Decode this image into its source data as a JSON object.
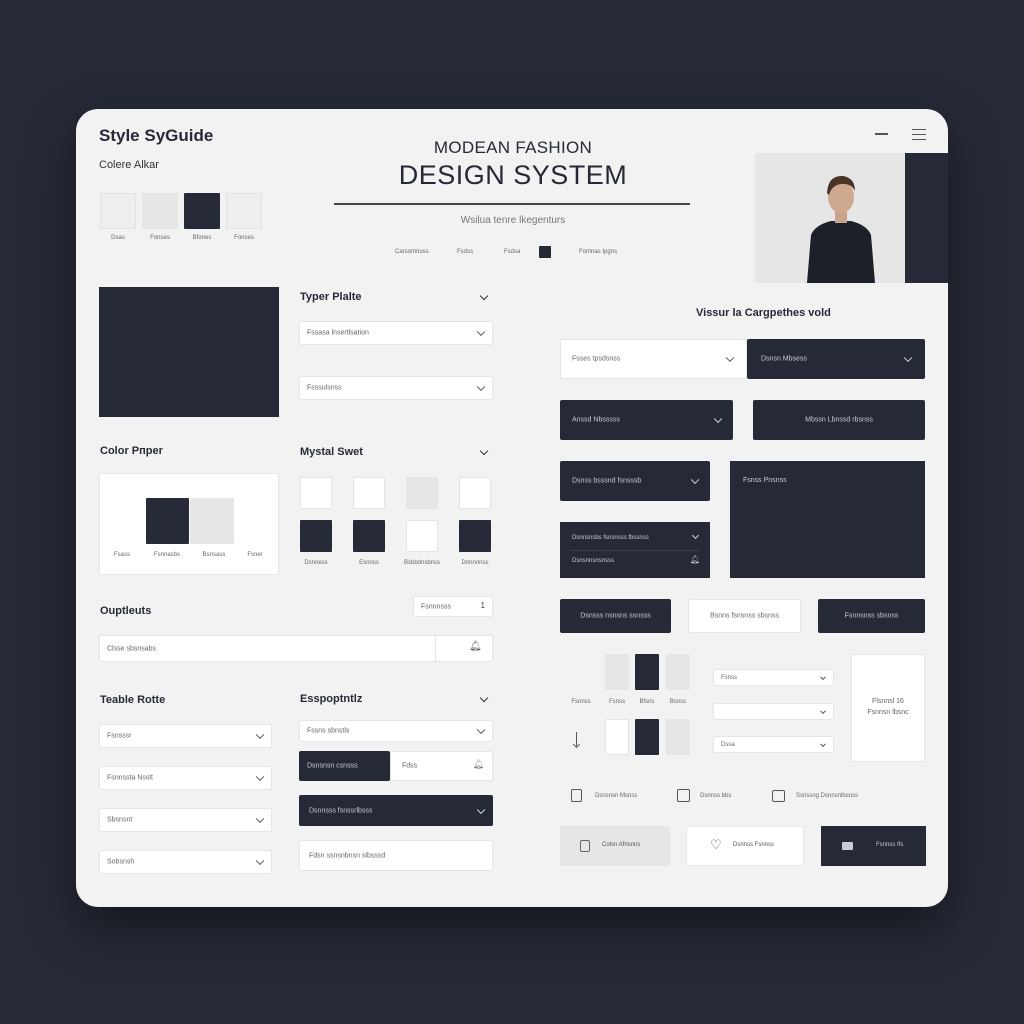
{
  "header": {
    "app_title": "Style SyGuide",
    "colors_label": "Colere Alkar",
    "hero_line1": "MODEAN FASHION",
    "hero_line2": "DESIGN SYSTEM",
    "hero_sub": "Wsilua tenre lkegenturs",
    "hero_links": [
      "Carsomnuss",
      "Fsdss",
      "Fsdsa",
      "Fomnas Ipgns"
    ]
  },
  "top_swatches": {
    "colors": [
      "#eeeeee",
      "#e6e6e6",
      "#262a36",
      "#eeeeee"
    ],
    "labels": [
      "Dsas",
      "Fonses",
      "Bfones",
      "Fonses"
    ]
  },
  "type_palette": {
    "title": "Typer Plalte",
    "fields": [
      "Fssasa lnsertlsation",
      "Fsssulsnss"
    ]
  },
  "color_paper": {
    "title": "Color Pпper",
    "labels": [
      "Fsass",
      "Fsnnasbs",
      "Bsnsass",
      "Fsner"
    ]
  },
  "mystal_swet": {
    "title": "Mystal Swet",
    "labels": [
      "Dsnness",
      "Esnnss",
      "Bsbbdnsbnss",
      "Dnnnnnss"
    ]
  },
  "outfields": {
    "title": "Ouptleuts",
    "counter_label": "Fsnnnsss",
    "counter_value": "1",
    "input_placeholder": "Clsse sbsnsabs"
  },
  "table_rotte": {
    "title": "Teable Rotte",
    "fields": [
      "Fsnsssr",
      "Fsnnssta Nsslt",
      "Sbsnsnt",
      "Sobsnsh"
    ]
  },
  "exports": {
    "title": "Esspoрtntlz",
    "field1": "Fssns sbnstls",
    "split_left": "Dsnsnsn csnsss",
    "split_right": "Fdss",
    "dark_select": "Dsnnsss fsnssrlbsss",
    "input_placeholder": "Fdsn ssnsnbnsn slbsssd"
  },
  "visual_components": {
    "title": "Vissur la Cargpethes vold",
    "row1_left": "Fsses tpsdsnss",
    "row1_right": "Dsnsn Mbsess",
    "row2_left": "Anssd Nbsssss",
    "row2_right": "Mbssn Lbnssd rbsnss",
    "row3_left": "Dsnss bsssnd fsnsssb",
    "card_label": "Fsnss Pnsnss",
    "stack_line1": "Dsnnsnsbs fsnsnsss fbssnss",
    "stack_line2": "Dsnsnnsnsnsss",
    "buttons": [
      "Dsnsss nsnsns ssnsss",
      "Bsnns fsnsnss sbsnss",
      "Fsnnsnss sbsnss"
    ],
    "mini_swatch_labels": [
      "Fsnnss",
      "Fsnss",
      "Bfsns",
      "Bsnss"
    ],
    "mini_selects": [
      "Fsnss",
      "",
      "Dssa"
    ],
    "side_card": "Flsnnsl 16\nFsnnsn lbsnc",
    "checks": [
      "Dsnsnsn Msnss",
      "Dsnnss bbs",
      "Ssnssng Dsnnsnlbsnss"
    ],
    "tiles": [
      "Colsn Afrlsnns",
      "Dsnnss Fsnnss",
      "Fsnnss Ifs"
    ]
  },
  "colors": {
    "background": "#262a36",
    "card": "#f2f2f2",
    "dark": "#262a36",
    "light": "#e6e6e6",
    "white": "#ffffff"
  },
  "icons": [
    "hamburger-menu-icon",
    "minimize-icon",
    "bell-icon",
    "chevron-down-icon",
    "arrow-down-icon",
    "checkbox-icon",
    "heart-icon",
    "card-icon"
  ]
}
